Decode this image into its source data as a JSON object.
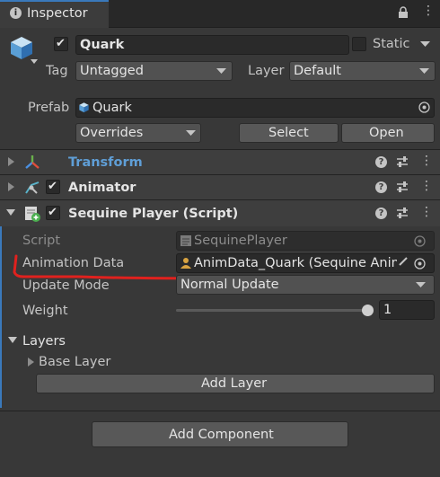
{
  "tab": {
    "title": "Inspector"
  },
  "object": {
    "name": "Quark",
    "static_label": "Static",
    "tag_label": "Tag",
    "tag_value": "Untagged",
    "layer_label": "Layer",
    "layer_value": "Default"
  },
  "prefab": {
    "label": "Prefab",
    "value": "Quark",
    "overrides": "Overrides",
    "select": "Select",
    "open": "Open"
  },
  "components": {
    "transform": "Transform",
    "animator": "Animator",
    "sequine": "Sequine Player (Script)"
  },
  "sequine": {
    "script_label": "Script",
    "script_value": "SequinePlayer",
    "animdata_label": "Animation Data",
    "animdata_value": "AnimData_Quark (Sequine Animat",
    "update_label": "Update Mode",
    "update_value": "Normal Update",
    "weight_label": "Weight",
    "weight_value": "1",
    "weight_level": 1.0,
    "layers_label": "Layers",
    "base_layer": "Base Layer",
    "add_layer": "Add Layer"
  },
  "add_component": "Add Component",
  "colors": {
    "accent": "#3a79bb",
    "transform_title": "#5f9ed6",
    "annotation": "#e0211e"
  }
}
